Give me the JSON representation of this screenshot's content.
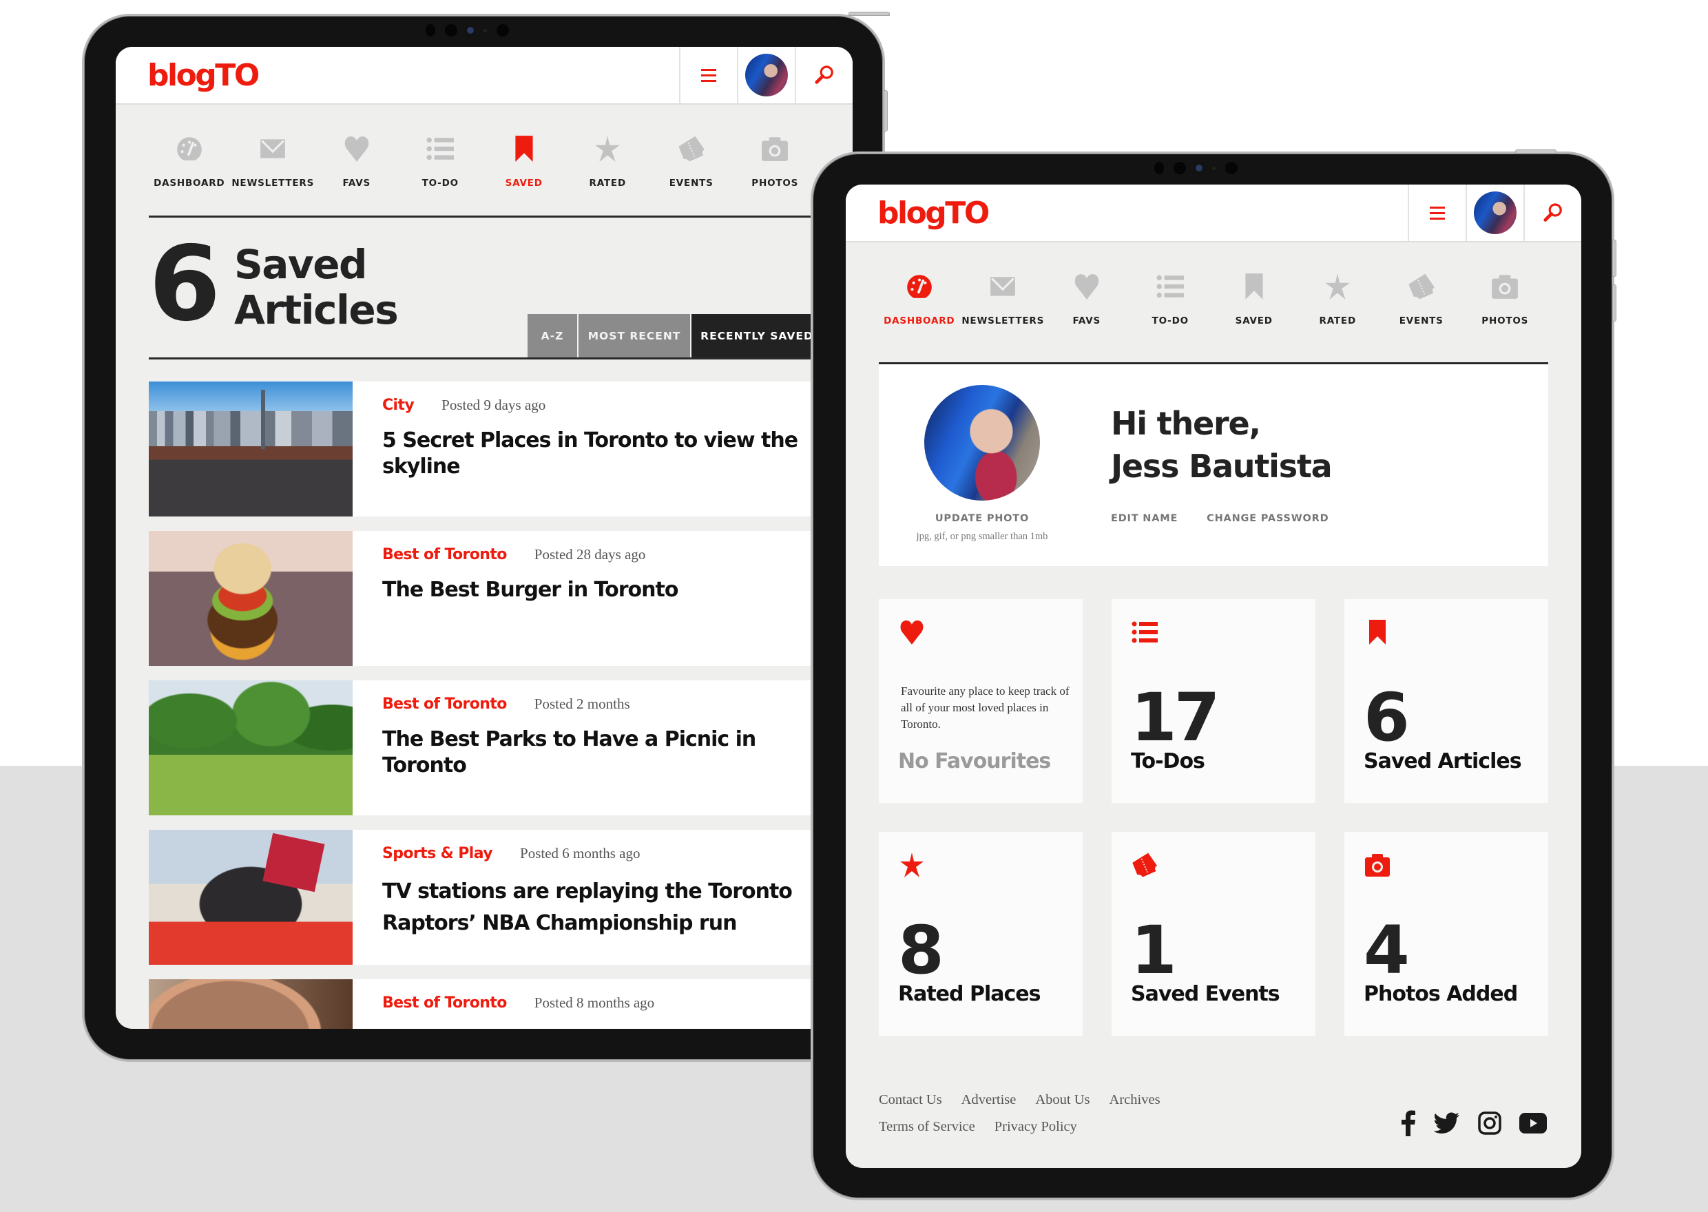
{
  "brand": {
    "logo": "blogTO",
    "accent_color": "#ee1c0e"
  },
  "header": {
    "menu_icon": "hamburger-icon",
    "avatar": "user-avatar",
    "search_icon": "search-icon"
  },
  "nav": {
    "items": [
      {
        "label": "DASHBOARD",
        "icon": "dashboard-gauge-icon"
      },
      {
        "label": "NEWSLETTERS",
        "icon": "envelope-icon"
      },
      {
        "label": "FAVS",
        "icon": "heart-icon"
      },
      {
        "label": "TO-DO",
        "icon": "list-icon"
      },
      {
        "label": "SAVED",
        "icon": "bookmark-icon"
      },
      {
        "label": "RATED",
        "icon": "star-icon"
      },
      {
        "label": "EVENTS",
        "icon": "ticket-icon"
      },
      {
        "label": "PHOTOS",
        "icon": "camera-icon"
      }
    ]
  },
  "saved_page": {
    "active_nav": "SAVED",
    "count": "6",
    "title_line1": "Saved",
    "title_line2": "Articles",
    "sort_tabs": [
      {
        "label": "A-Z",
        "active": false
      },
      {
        "label": "MOST RECENT",
        "active": false
      },
      {
        "label": "RECENTLY SAVED",
        "active": true
      }
    ],
    "articles": [
      {
        "category": "City",
        "posted": "Posted 9 days ago",
        "title": "5 Secret Places in Toronto to view the skyline",
        "image": "toronto-skyline-photo"
      },
      {
        "category": "Best of Toronto",
        "posted": "Posted 28 days ago",
        "title": "The Best Burger in Toronto",
        "image": "burger-photo"
      },
      {
        "category": "Best of Toronto",
        "posted": "Posted 2 months",
        "title": "The Best Parks to Have a Picnic in Toronto",
        "image": "park-picnic-photo"
      },
      {
        "category": "Sports & Play",
        "posted": "Posted 6 months ago",
        "title": "TV stations are replaying the Toronto Raptors’ NBA Championship run",
        "image": "raptors-parade-photo"
      },
      {
        "category": "Best of Toronto",
        "posted": "Posted 8 months ago",
        "title": "",
        "image": "hot-chocolate-photo"
      }
    ]
  },
  "dashboard_page": {
    "active_nav": "DASHBOARD",
    "greeting_line1": "Hi there,",
    "greeting_line2": "Jess Bautista",
    "update_photo": "UPDATE PHOTO",
    "photo_hint": "jpg, gif, or png smaller than 1mb",
    "edit_name": "EDIT NAME",
    "change_password": "CHANGE PASSWORD",
    "stats": [
      {
        "icon": "heart-icon",
        "value": "",
        "label": "No Favourites",
        "description": "Favourite any place to keep track of all of your most loved places in Toronto.",
        "empty": true
      },
      {
        "icon": "list-icon",
        "value": "17",
        "label": "To-Dos"
      },
      {
        "icon": "bookmark-icon",
        "value": "6",
        "label": "Saved Articles"
      },
      {
        "icon": "star-icon",
        "value": "8",
        "label": "Rated Places"
      },
      {
        "icon": "ticket-icon",
        "value": "1",
        "label": "Saved Events"
      },
      {
        "icon": "camera-icon",
        "value": "4",
        "label": "Photos Added"
      }
    ],
    "footer": {
      "links_row1": [
        "Contact Us",
        "Advertise",
        "About Us",
        "Archives"
      ],
      "links_row2": [
        "Terms of Service",
        "Privacy Policy"
      ],
      "socials": [
        "facebook-icon",
        "twitter-icon",
        "instagram-icon",
        "youtube-icon"
      ]
    }
  }
}
